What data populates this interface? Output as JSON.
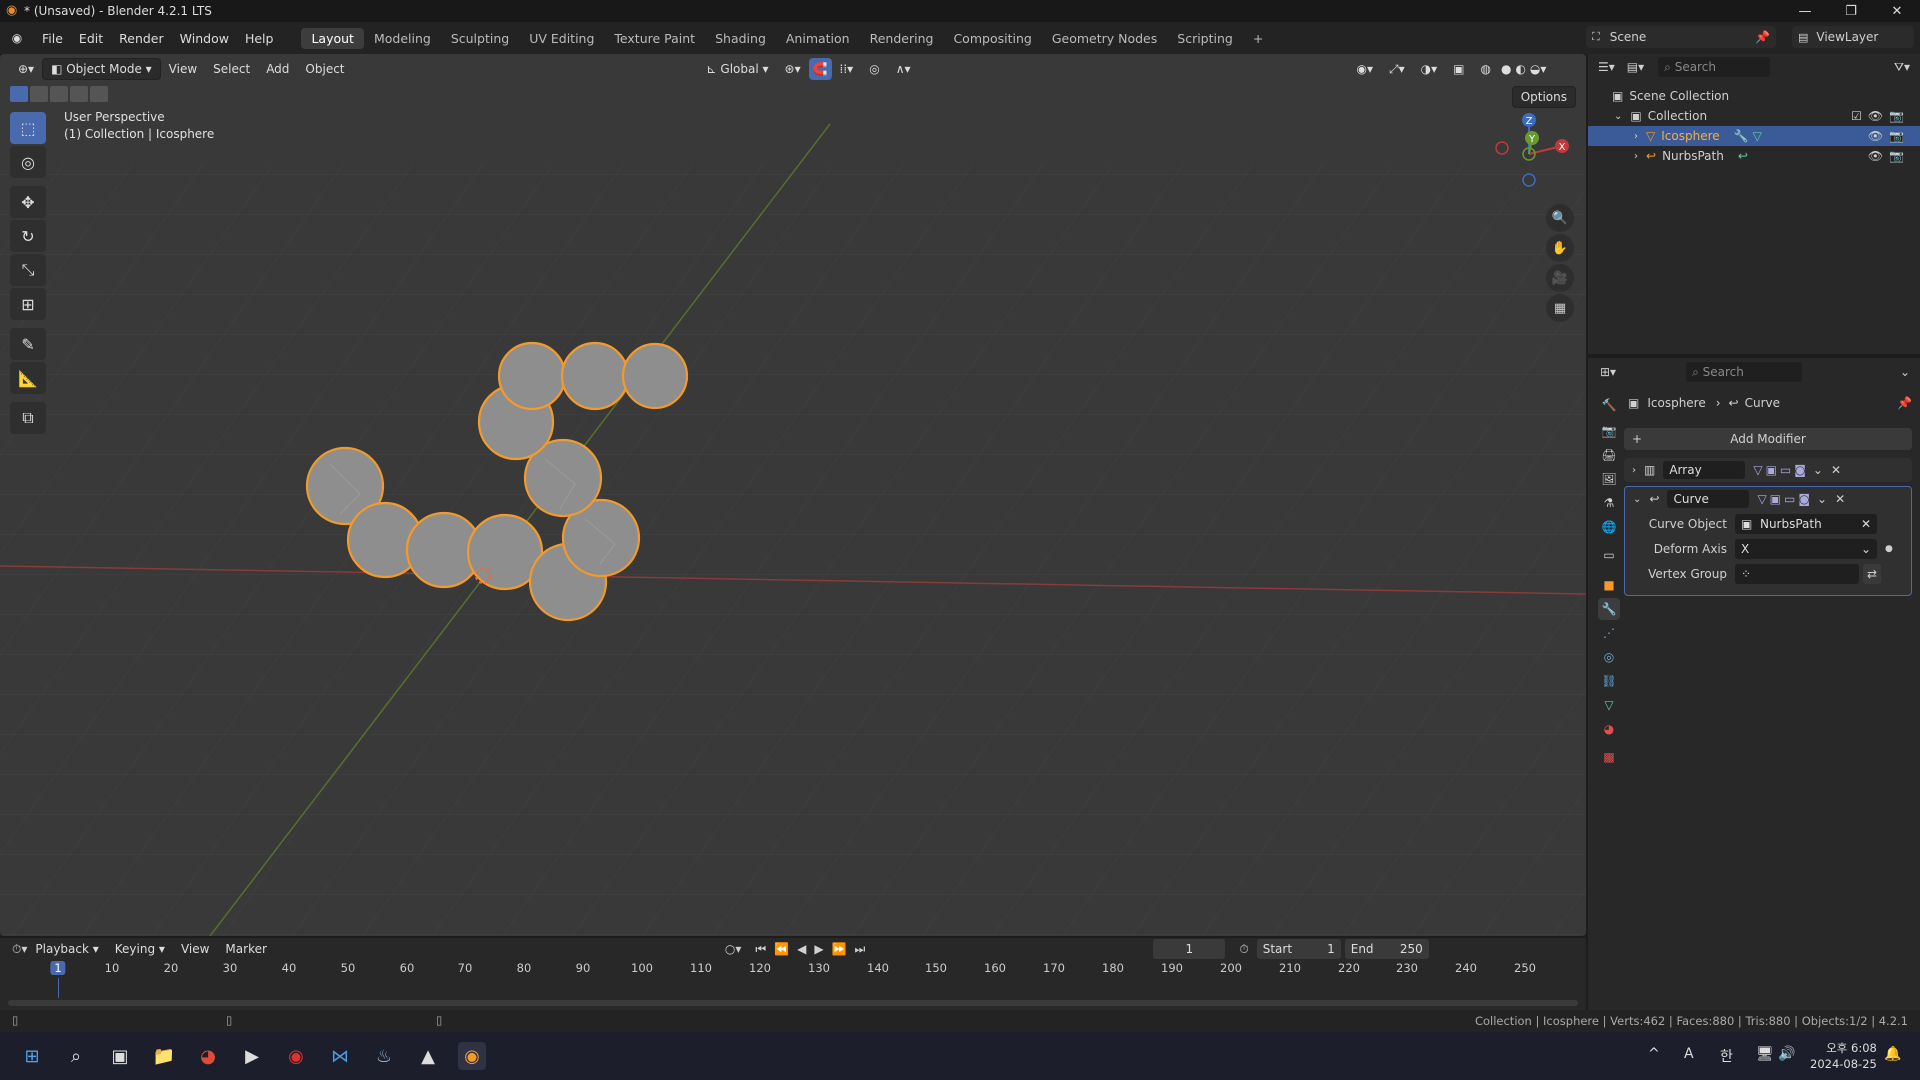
{
  "window": {
    "title": "* (Unsaved) - Blender 4.2.1 LTS",
    "minimize": "—",
    "maximize": "❐",
    "close": "✕"
  },
  "menu": {
    "items": [
      "File",
      "Edit",
      "Render",
      "Window",
      "Help"
    ]
  },
  "workspaces": [
    "Layout",
    "Modeling",
    "Sculpting",
    "UV Editing",
    "Texture Paint",
    "Shading",
    "Animation",
    "Rendering",
    "Compositing",
    "Geometry Nodes",
    "Scripting",
    "+"
  ],
  "active_workspace": "Layout",
  "scene": {
    "label": "Scene",
    "view_layer": "ViewLayer"
  },
  "viewport": {
    "mode": "Object Mode",
    "menus": [
      "View",
      "Select",
      "Add",
      "Object"
    ],
    "transform_orientation": "Global",
    "options": "Options",
    "overlay_line1": "User Perspective",
    "overlay_line2": "(1) Collection | Icosphere",
    "gizmo": {
      "z": "Z",
      "y": "Y",
      "x": "X"
    }
  },
  "outliner": {
    "search_placeholder": "Search",
    "rows": [
      {
        "label": "Scene Collection"
      },
      {
        "label": "Collection"
      },
      {
        "label": "Icosphere",
        "selected": true
      },
      {
        "label": "NurbsPath"
      }
    ]
  },
  "properties": {
    "search_placeholder": "Search",
    "breadcrumb_object": "Icosphere",
    "breadcrumb_sep": "›",
    "breadcrumb_modifier": "Curve",
    "add_modifier": "Add Modifier",
    "modifiers": [
      {
        "name": "Array",
        "expanded": false
      },
      {
        "name": "Curve",
        "expanded": true
      }
    ],
    "curve_fields": {
      "curve_object_label": "Curve Object",
      "curve_object_value": "NurbsPath",
      "deform_axis_label": "Deform Axis",
      "deform_axis_value": "X",
      "vertex_group_label": "Vertex Group",
      "vertex_group_value": ""
    }
  },
  "timeline": {
    "menus": [
      "Playback",
      "Keying",
      "View",
      "Marker"
    ],
    "current_frame": "1",
    "start_label": "Start",
    "start_value": "1",
    "end_label": "End",
    "end_value": "250",
    "ticks": [
      "1",
      "10",
      "20",
      "30",
      "40",
      "50",
      "60",
      "70",
      "80",
      "90",
      "100",
      "110",
      "120",
      "130",
      "140",
      "150",
      "160",
      "170",
      "180",
      "190",
      "200",
      "210",
      "220",
      "230",
      "240",
      "250"
    ]
  },
  "status": {
    "text": "Collection | Icosphere | Verts:462 | Faces:880 | Tris:880 | Objects:1/2 | 4.2.1"
  },
  "taskbar": {
    "time": "오후 6:08",
    "date": "2024-08-25",
    "ime1": "A",
    "ime2": "한",
    "chevron": "^"
  },
  "colors": {
    "accent": "#4a6ab0",
    "selection": "#f39a2b",
    "x_axis": "#c0393b",
    "y_axis": "#6a9a2e",
    "z_axis": "#3b6cc0"
  }
}
